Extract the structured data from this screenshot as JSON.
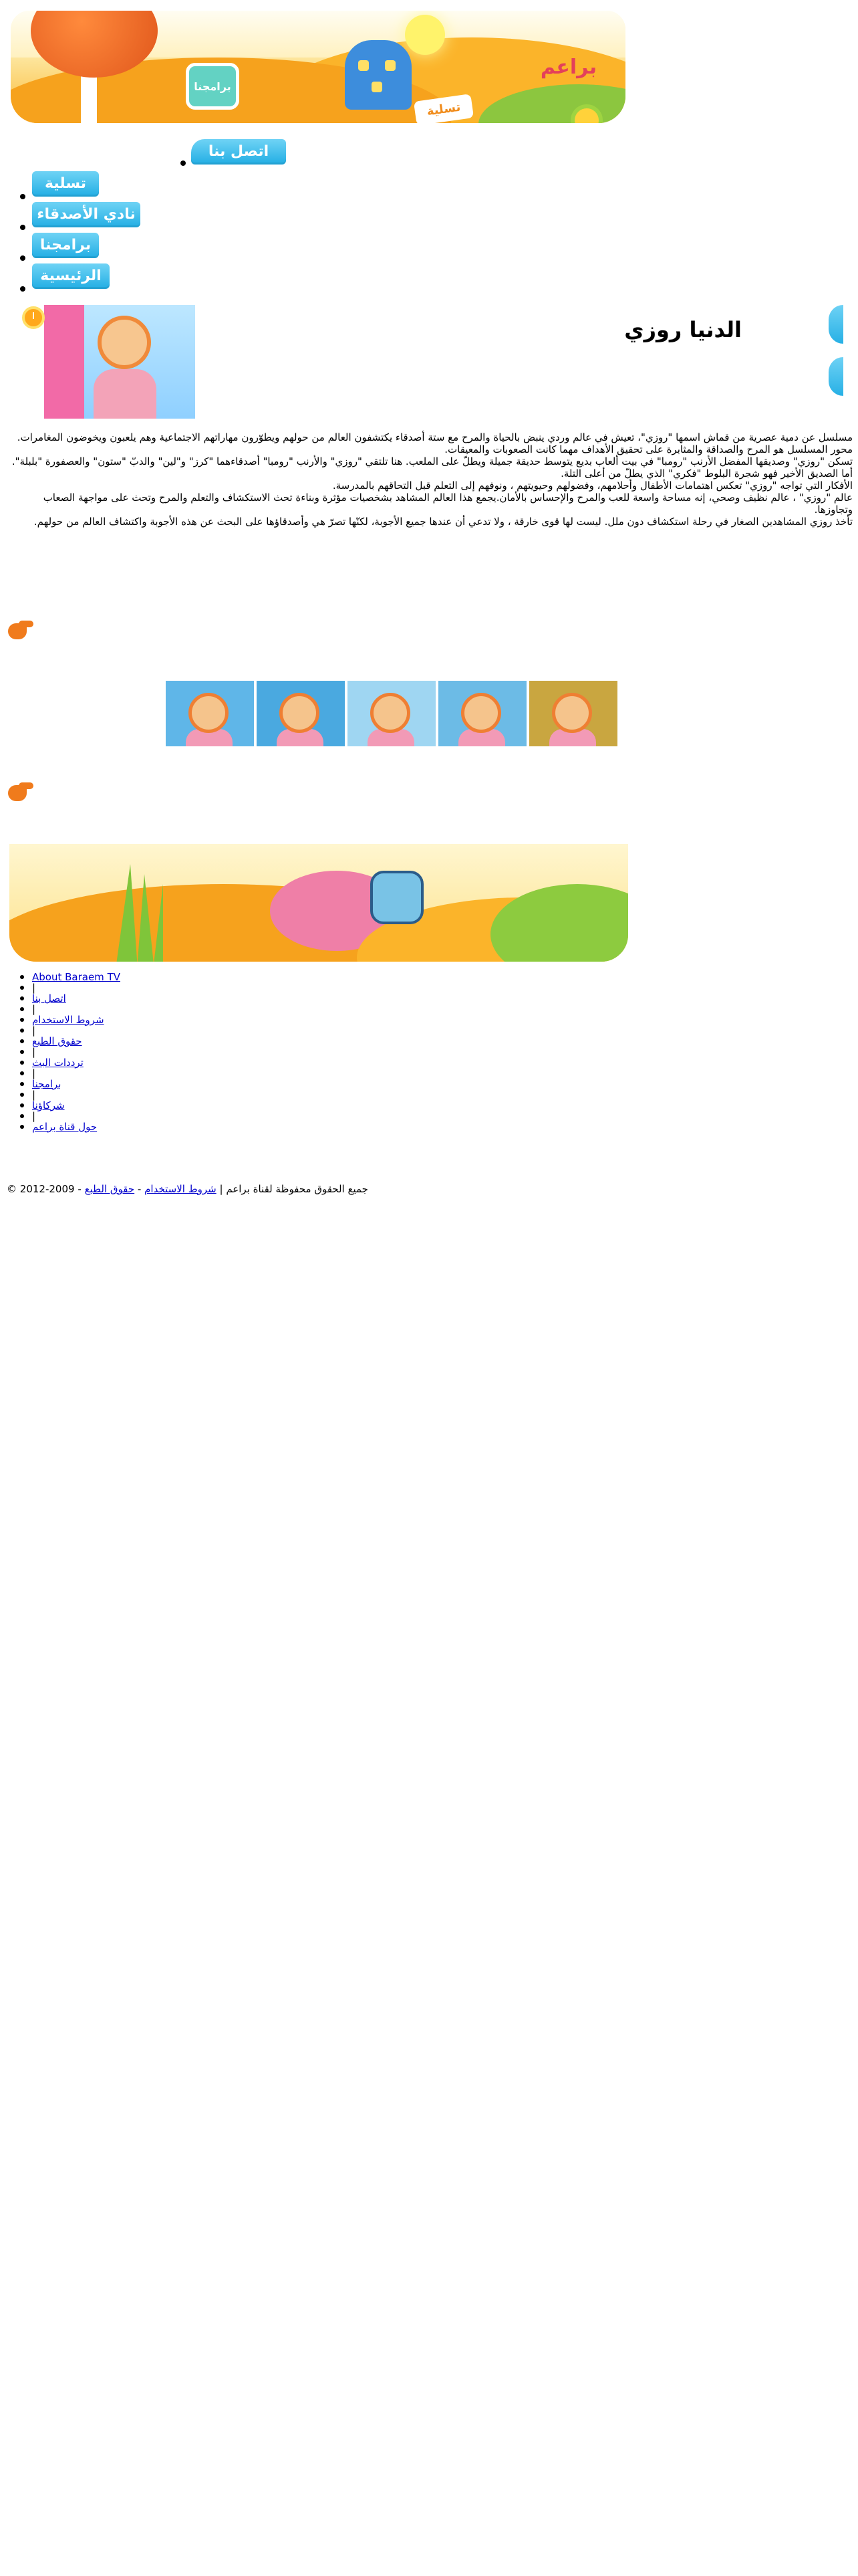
{
  "banner": {
    "tv_label": "برامجنا",
    "sign_label": "تسلية",
    "logo_text": "براعم"
  },
  "nav": {
    "items": [
      {
        "label": "اتصل بنا"
      },
      {
        "label": "تسلية"
      },
      {
        "label": "نادي الأصدقاء"
      },
      {
        "label": "برامجنا"
      },
      {
        "label": "الرئيسية"
      }
    ]
  },
  "page": {
    "title": "الدنيا روزي"
  },
  "description": [
    "مسلسل عن دمية عصرية من قماش اسمها \"روزي\"، تعيش في عالم وردي ينبض بالحياة والمرح مع ستة أصدقاء يكتشفون العالم من حولهم ويطوّرون مهاراتهم الاجتماعية وهم يلعبون ويخوضون المغامرات.",
    "محور المسلسل هو المرح والصداقة والمثابرة على تحقيق الأهداف مهما كانت الصعوبات والمعيقات.",
    "تسكن \"روزي\" وصديقها المفضل الأرنب \"رومبا\" في بيت ألعاب بديع يتوسط حديقة جميلة ويطلّ على الملعب. هنا تلتقي \"روزي\" والأرنب \"رومبا\" أصدقاءهما \"كرز\" و\"لين\" والدبّ \"ستون\" والعصفورة \"بلبلة\". أما الصديق الأخير فهو شجرة البلوط \"فكري\" الذي يطلّ من أعلى التلة.",
    "الأفكار التي تواجه \"روزي\" تعكس اهتمامات الأطفال وأحلامهم، وفضولهم وحيويتهم ، ونوفهم إلى التعلم قبل التحاقهم بالمدرسة.",
    "عالم \"روزي\" ، عالم نظيف وصحي، إنه مساحة واسعة للعب والمرح والإحساس بالأمان.يجمع هذا العالم المشاهد بشخصيات مؤثرة وبناءة تحث الاستكشاف والتعلم والمرح وتحث على مواجهة الصعاب وتجاوزها.",
    "تأخذ روزي المشاهدين الصغار في رحلة استكشاف دون ملل. ليست لها قوى خارقة ، ولا تدعي أن عندها جميع الأجوبة، لكنّها تصرّ هي وأصدقاؤها على البحث عن هذه الأجوبة واكتشاف العالم من حولهم."
  ],
  "thumbnails": [
    {
      "bg": "#5fb6e8"
    },
    {
      "bg": "#4aa9e0"
    },
    {
      "bg": "#9fd6f2"
    },
    {
      "bg": "#6cbbe6"
    },
    {
      "bg": "#c9a640"
    }
  ],
  "footer": {
    "links": [
      "About Baraem TV",
      "اتصل بنا",
      "شروط الاستخدام",
      "حقوق الطبع",
      "ترددات البث",
      "برامجنا",
      "شركاؤنا",
      "حول قناة براعم"
    ],
    "separator": "|",
    "copyright_text": "جميع الحقوق محفوظة لقناة براعم",
    "copyright_sep": "|",
    "terms_link": "شروط الاستخدام",
    "dash": "-",
    "rights_link": "حقوق الطبع",
    "years": "2009-2012 ©"
  },
  "colors": {
    "nav_button": "#22aee4",
    "accent_orange": "#f07b1c",
    "link": "#0000cc"
  }
}
